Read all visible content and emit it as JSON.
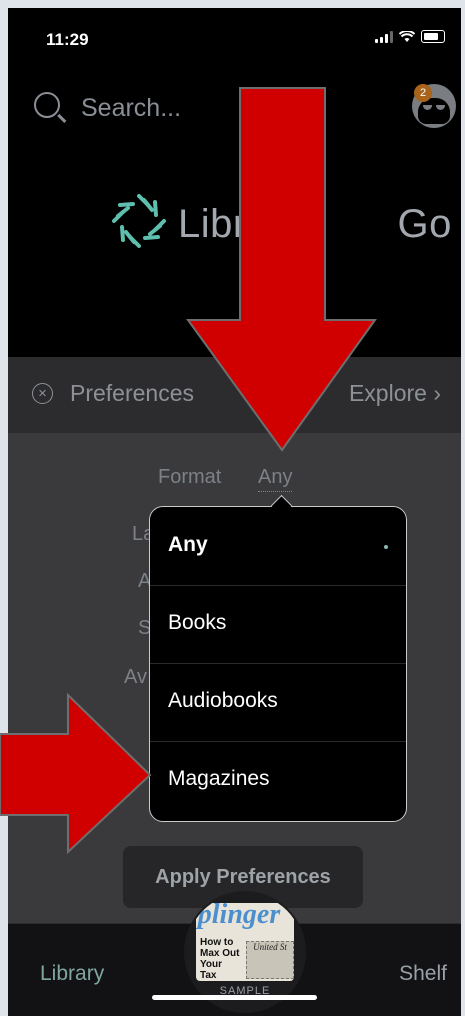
{
  "status_bar": {
    "time": "11:29"
  },
  "search": {
    "placeholder": "Search..."
  },
  "account": {
    "badge_count": "2"
  },
  "logo": {
    "text_left": "Libra",
    "text_right": "Go"
  },
  "preferences_bar": {
    "label": "Preferences",
    "explore_label": "Explore"
  },
  "filters": {
    "format_label": "Format",
    "format_value": "Any",
    "hidden_rows": [
      "La",
      "A",
      "S",
      "Av"
    ]
  },
  "dropdown": {
    "options": [
      {
        "label": "Any",
        "selected": true
      },
      {
        "label": "Books",
        "selected": false
      },
      {
        "label": "Audiobooks",
        "selected": false
      },
      {
        "label": "Magazines",
        "selected": false
      }
    ]
  },
  "apply_button": {
    "label": "Apply Preferences"
  },
  "bottom_nav": {
    "library": "Library",
    "shelf": "Shelf"
  },
  "sample": {
    "label": "SAMPLE",
    "magazine_title": "iplinger",
    "cover_lines": "How to Max Out Your Tax",
    "cover_stamp": "United St"
  },
  "colors": {
    "annotation_arrow": "#d10000",
    "accent": "#7fa79f",
    "badge": "#a8641a"
  },
  "icons": [
    "search-icon",
    "avatar-icon",
    "close-circle-icon",
    "chevron-right-icon",
    "logo-icon",
    "selected-dot-icon"
  ]
}
